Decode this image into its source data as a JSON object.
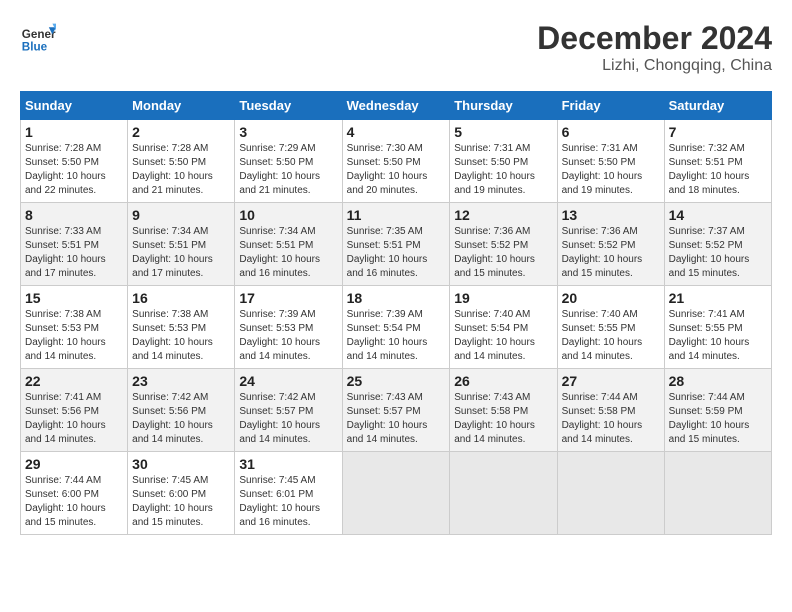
{
  "logo": {
    "line1": "General",
    "line2": "Blue"
  },
  "title": "December 2024",
  "subtitle": "Lizhi, Chongqing, China",
  "weekdays": [
    "Sunday",
    "Monday",
    "Tuesday",
    "Wednesday",
    "Thursday",
    "Friday",
    "Saturday"
  ],
  "weeks": [
    [
      {
        "day": "1",
        "info": "Sunrise: 7:28 AM\nSunset: 5:50 PM\nDaylight: 10 hours\nand 22 minutes."
      },
      {
        "day": "2",
        "info": "Sunrise: 7:28 AM\nSunset: 5:50 PM\nDaylight: 10 hours\nand 21 minutes."
      },
      {
        "day": "3",
        "info": "Sunrise: 7:29 AM\nSunset: 5:50 PM\nDaylight: 10 hours\nand 21 minutes."
      },
      {
        "day": "4",
        "info": "Sunrise: 7:30 AM\nSunset: 5:50 PM\nDaylight: 10 hours\nand 20 minutes."
      },
      {
        "day": "5",
        "info": "Sunrise: 7:31 AM\nSunset: 5:50 PM\nDaylight: 10 hours\nand 19 minutes."
      },
      {
        "day": "6",
        "info": "Sunrise: 7:31 AM\nSunset: 5:50 PM\nDaylight: 10 hours\nand 19 minutes."
      },
      {
        "day": "7",
        "info": "Sunrise: 7:32 AM\nSunset: 5:51 PM\nDaylight: 10 hours\nand 18 minutes."
      }
    ],
    [
      {
        "day": "8",
        "info": "Sunrise: 7:33 AM\nSunset: 5:51 PM\nDaylight: 10 hours\nand 17 minutes."
      },
      {
        "day": "9",
        "info": "Sunrise: 7:34 AM\nSunset: 5:51 PM\nDaylight: 10 hours\nand 17 minutes."
      },
      {
        "day": "10",
        "info": "Sunrise: 7:34 AM\nSunset: 5:51 PM\nDaylight: 10 hours\nand 16 minutes."
      },
      {
        "day": "11",
        "info": "Sunrise: 7:35 AM\nSunset: 5:51 PM\nDaylight: 10 hours\nand 16 minutes."
      },
      {
        "day": "12",
        "info": "Sunrise: 7:36 AM\nSunset: 5:52 PM\nDaylight: 10 hours\nand 15 minutes."
      },
      {
        "day": "13",
        "info": "Sunrise: 7:36 AM\nSunset: 5:52 PM\nDaylight: 10 hours\nand 15 minutes."
      },
      {
        "day": "14",
        "info": "Sunrise: 7:37 AM\nSunset: 5:52 PM\nDaylight: 10 hours\nand 15 minutes."
      }
    ],
    [
      {
        "day": "15",
        "info": "Sunrise: 7:38 AM\nSunset: 5:53 PM\nDaylight: 10 hours\nand 14 minutes."
      },
      {
        "day": "16",
        "info": "Sunrise: 7:38 AM\nSunset: 5:53 PM\nDaylight: 10 hours\nand 14 minutes."
      },
      {
        "day": "17",
        "info": "Sunrise: 7:39 AM\nSunset: 5:53 PM\nDaylight: 10 hours\nand 14 minutes."
      },
      {
        "day": "18",
        "info": "Sunrise: 7:39 AM\nSunset: 5:54 PM\nDaylight: 10 hours\nand 14 minutes."
      },
      {
        "day": "19",
        "info": "Sunrise: 7:40 AM\nSunset: 5:54 PM\nDaylight: 10 hours\nand 14 minutes."
      },
      {
        "day": "20",
        "info": "Sunrise: 7:40 AM\nSunset: 5:55 PM\nDaylight: 10 hours\nand 14 minutes."
      },
      {
        "day": "21",
        "info": "Sunrise: 7:41 AM\nSunset: 5:55 PM\nDaylight: 10 hours\nand 14 minutes."
      }
    ],
    [
      {
        "day": "22",
        "info": "Sunrise: 7:41 AM\nSunset: 5:56 PM\nDaylight: 10 hours\nand 14 minutes."
      },
      {
        "day": "23",
        "info": "Sunrise: 7:42 AM\nSunset: 5:56 PM\nDaylight: 10 hours\nand 14 minutes."
      },
      {
        "day": "24",
        "info": "Sunrise: 7:42 AM\nSunset: 5:57 PM\nDaylight: 10 hours\nand 14 minutes."
      },
      {
        "day": "25",
        "info": "Sunrise: 7:43 AM\nSunset: 5:57 PM\nDaylight: 10 hours\nand 14 minutes."
      },
      {
        "day": "26",
        "info": "Sunrise: 7:43 AM\nSunset: 5:58 PM\nDaylight: 10 hours\nand 14 minutes."
      },
      {
        "day": "27",
        "info": "Sunrise: 7:44 AM\nSunset: 5:58 PM\nDaylight: 10 hours\nand 14 minutes."
      },
      {
        "day": "28",
        "info": "Sunrise: 7:44 AM\nSunset: 5:59 PM\nDaylight: 10 hours\nand 15 minutes."
      }
    ],
    [
      {
        "day": "29",
        "info": "Sunrise: 7:44 AM\nSunset: 6:00 PM\nDaylight: 10 hours\nand 15 minutes."
      },
      {
        "day": "30",
        "info": "Sunrise: 7:45 AM\nSunset: 6:00 PM\nDaylight: 10 hours\nand 15 minutes."
      },
      {
        "day": "31",
        "info": "Sunrise: 7:45 AM\nSunset: 6:01 PM\nDaylight: 10 hours\nand 16 minutes."
      },
      null,
      null,
      null,
      null
    ]
  ]
}
